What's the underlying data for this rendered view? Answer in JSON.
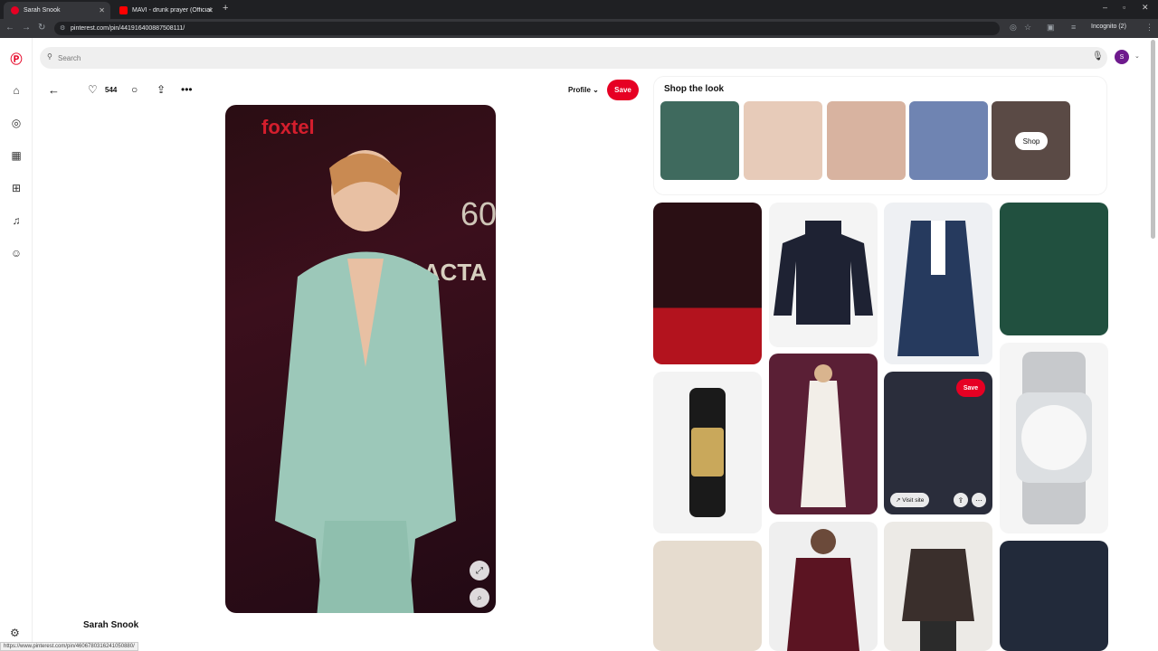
{
  "browser": {
    "tabs": [
      {
        "title": "Sarah Snook",
        "active": true,
        "favicon_color": "#e60023"
      },
      {
        "title": "MAVI - drunk prayer (Official V...",
        "active": false,
        "favicon_color": "#ff0000"
      }
    ],
    "url": "pinterest.com/pin/441916400887508111/",
    "incognito_label": "Incognito (2)",
    "status_url": "https://www.pinterest.com/pin/4606780316241050880/"
  },
  "search": {
    "placeholder": "Search"
  },
  "user": {
    "avatar_letter": "S"
  },
  "pin": {
    "like_count": "544",
    "profile_label": "Profile",
    "save_label": "Save",
    "title": "Sarah Snook"
  },
  "shop_the_look": {
    "title": "Shop the look",
    "shop_button": "Shop",
    "items": [
      {
        "name": "green-blazer",
        "color": "#3f6a5e"
      },
      {
        "name": "necklace-1",
        "color": "#e7cbb9"
      },
      {
        "name": "necklace-2",
        "color": "#d8b3a0"
      },
      {
        "name": "blue-trousers",
        "color": "#6f84b2"
      },
      {
        "name": "necklace-3",
        "color": "#5a4a45"
      }
    ]
  },
  "grid": {
    "save_label": "Save",
    "visit_label": "Visit site"
  },
  "colors": {
    "brand": "#e60023"
  }
}
